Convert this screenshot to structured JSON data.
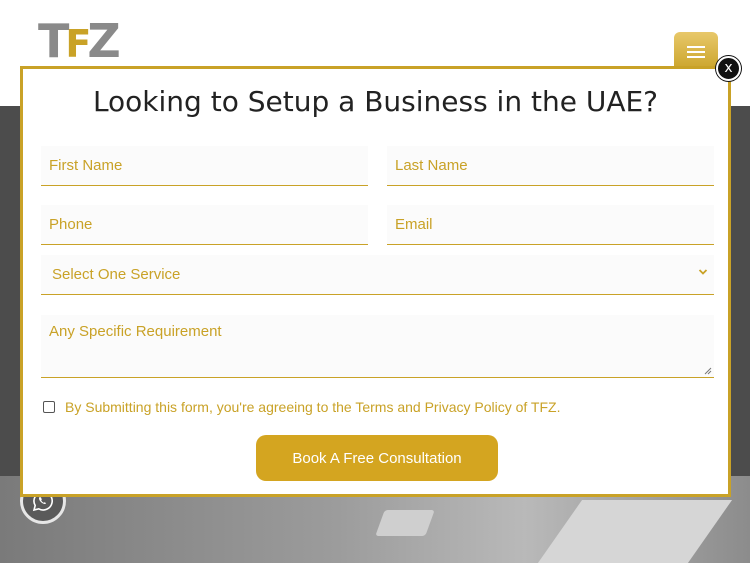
{
  "header": {
    "logo": {
      "t": "T",
      "f": "F",
      "z": "Z"
    }
  },
  "modal": {
    "title": "Looking to Setup a Business in the UAE?",
    "close_label": "x",
    "fields": {
      "first_name_placeholder": "First Name",
      "last_name_placeholder": "Last Name",
      "phone_placeholder": "Phone",
      "email_placeholder": "Email",
      "service_select_value": "Select One Service",
      "requirement_placeholder": "Any Specific Requirement"
    },
    "consent_text": "By Submitting this form, you're agreeing to the Terms and Privacy Policy of TFZ.",
    "submit_label": "Book A Free Consultation"
  },
  "colors": {
    "accent": "#c9a227",
    "button": "#d4a520",
    "overlay": "#4c4c4c"
  },
  "icons": {
    "menu": "hamburger-menu-icon",
    "close": "close-icon",
    "whatsapp": "whatsapp-icon",
    "select": "chevron-down-icon"
  }
}
